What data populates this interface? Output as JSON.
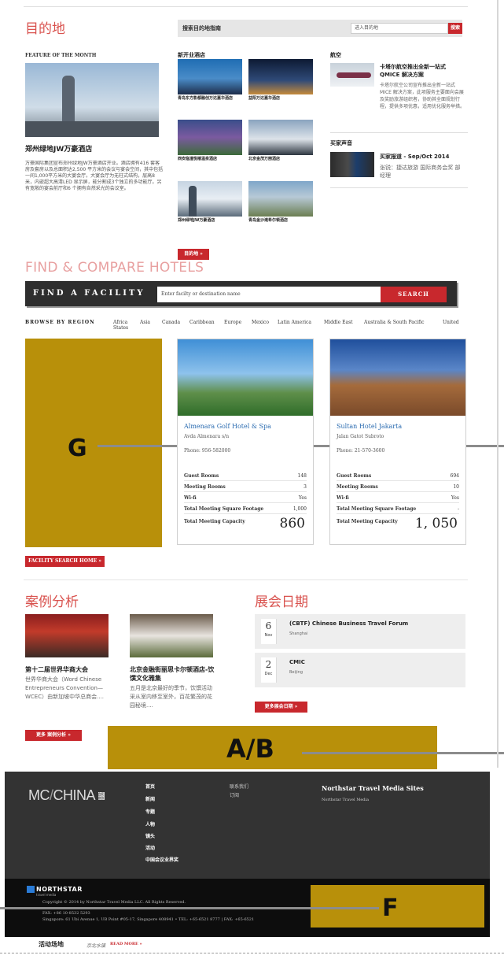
{
  "destinations": {
    "title": "目的地",
    "search_label": "搜索目的地指南",
    "search_placeholder": "进入目的地",
    "search_button": "搜索",
    "featured_label": "FEATURE OF THE MONTH",
    "featured_title": "郑州绿地JW万豪酒店",
    "featured_text": "万豪国际集团宣布郑州绿地JW万豪酒店开业。酒店拥有416 套客房及套房以及总面积达2,500 平方米的会议与宴会空间，其中包括一间1,000平方米的大宴会厅。大宴会厅为无柱式结构，层高8 米，内嵌超大高清LED 显示屏，能分割成3个独立的多功能厅。另有宽敞的宴会前厅和6 个拥有自然采光的会议室。",
    "new_hotels_label": "新开业酒店",
    "hotels": [
      {
        "name": "青岛东方影都融创万达嘉华酒店"
      },
      {
        "name": "益阳万达嘉华酒店"
      },
      {
        "name": "西安临潼悦椿温泉酒店"
      },
      {
        "name": "北京金茂万丽酒店"
      },
      {
        "name": "郑州绿地JW万豪酒店"
      },
      {
        "name": "青岛金沙滩希尔顿酒店"
      }
    ],
    "more_button": "目的地 »",
    "aviation_label": "航空",
    "aviation_title": "卡塔尔航空推出全新一站式QMICE 解决方案",
    "aviation_text": "卡塔尔航空公司宣布推出全新一站式MICE 解决方案，此项服务主要面向会展及奖励旅游组织者，协助其全面规划行程，提供多项优惠，适用优化服务举措。",
    "buyer_label": "买家声音",
    "buyer_title": "买家报道 - Sep/Oct 2014",
    "buyer_text": "张锐：捷达旅游 国际商务会奖 部经理"
  },
  "find": {
    "title": "FIND & COMPARE HOTELS",
    "bar_label": "FIND A FACILITY",
    "input_placeholder": "Enter facilty or destination name",
    "search_button": "SEARCH",
    "region_label": "BROWSE BY REGION",
    "regions": [
      "Africa States",
      "Asia",
      "Canada",
      "Caribbean",
      "Europe",
      "Mexico",
      "Latin America",
      "Middle East",
      "Australia & South Pacific",
      "United"
    ],
    "cards": [
      {
        "name": "Almenara Golf Hotel & Spa",
        "address": "Avda Almenara s/n",
        "phone": "Phone: 956-582000",
        "stats": [
          {
            "k": "Guest Rooms",
            "v": "148"
          },
          {
            "k": "Meeting Rooms",
            "v": "3"
          },
          {
            "k": "Wi-fi",
            "v": "Yes"
          },
          {
            "k": "Total Meeting Square Footage",
            "v": "1,000"
          }
        ],
        "capacity_label": "Total Meeting Capacity",
        "capacity": "860"
      },
      {
        "name": "Sultan Hotel Jakarta",
        "address": "Jalan Gatot Subroto",
        "phone": "Phone: 21-570-3600",
        "stats": [
          {
            "k": "Guest Rooms",
            "v": "694"
          },
          {
            "k": "Meeting Rooms",
            "v": "10"
          },
          {
            "k": "Wi-fi",
            "v": "Yes"
          },
          {
            "k": "Total Meeting Square Footage",
            "v": "-"
          }
        ],
        "capacity_label": "Total Meeting Capacity",
        "capacity": "1, 050"
      }
    ],
    "facility_home_button": "FACILITY SEARCH HOME »"
  },
  "cases": {
    "title": "案例分析",
    "items": [
      {
        "title": "第十二届世界华商大会",
        "text": "世界华商大会（Word Chinese Entrepreneurs Convention—WCEC）由新加坡中华总商会...."
      },
      {
        "title": "北京金融街丽思卡尔顿酒店-饮馔文化雅集",
        "text": "五月是北京最好的季节，饮馔活动采从室内移至室外，百花繁茂的花园秘境...."
      }
    ],
    "more_button": "更多 案例分析 »"
  },
  "events": {
    "title": "展会日期",
    "items": [
      {
        "day": "6",
        "month": "Nov",
        "title": "(CBTF) Chinese Business Travel Forum",
        "city": "Shanghai"
      },
      {
        "day": "2",
        "month": "Dec",
        "title": "CMIC",
        "city": "Beijing"
      }
    ],
    "more_button": "更多展会日期 »"
  },
  "annotations": {
    "g": "G",
    "ab": "A/B",
    "f": "F"
  },
  "footer": {
    "logo_mc": "MC",
    "logo_china": "CHINA",
    "logo_badge": "会奖旅游",
    "links_col1": [
      "首页",
      "新闻",
      "专题",
      "人物",
      "镜头",
      "活动",
      "中国会议业界奖"
    ],
    "links_col2": [
      "联系我们",
      "订阅"
    ],
    "sites_title": "Northstar Travel Media Sites",
    "sites_link": "Northstar Travel Media",
    "northstar_logo": "NORTHSTAR",
    "northstar_sub": "travel media",
    "copyright": "Copyright © 2014 by Northstar Travel Media LLC. All Rights Reserved.",
    "fax": "FAX: +86 10-8532 5293",
    "singapore": "Singapore: 61 Ubi Avenue 1, UB Point #05-17, Singapore 408941 • TEL: +65-6521 8777 | FAX: +65-6521"
  },
  "bottom": {
    "label": "活动场地",
    "venue": "京北水镇",
    "read_more": "READ MORE »"
  }
}
